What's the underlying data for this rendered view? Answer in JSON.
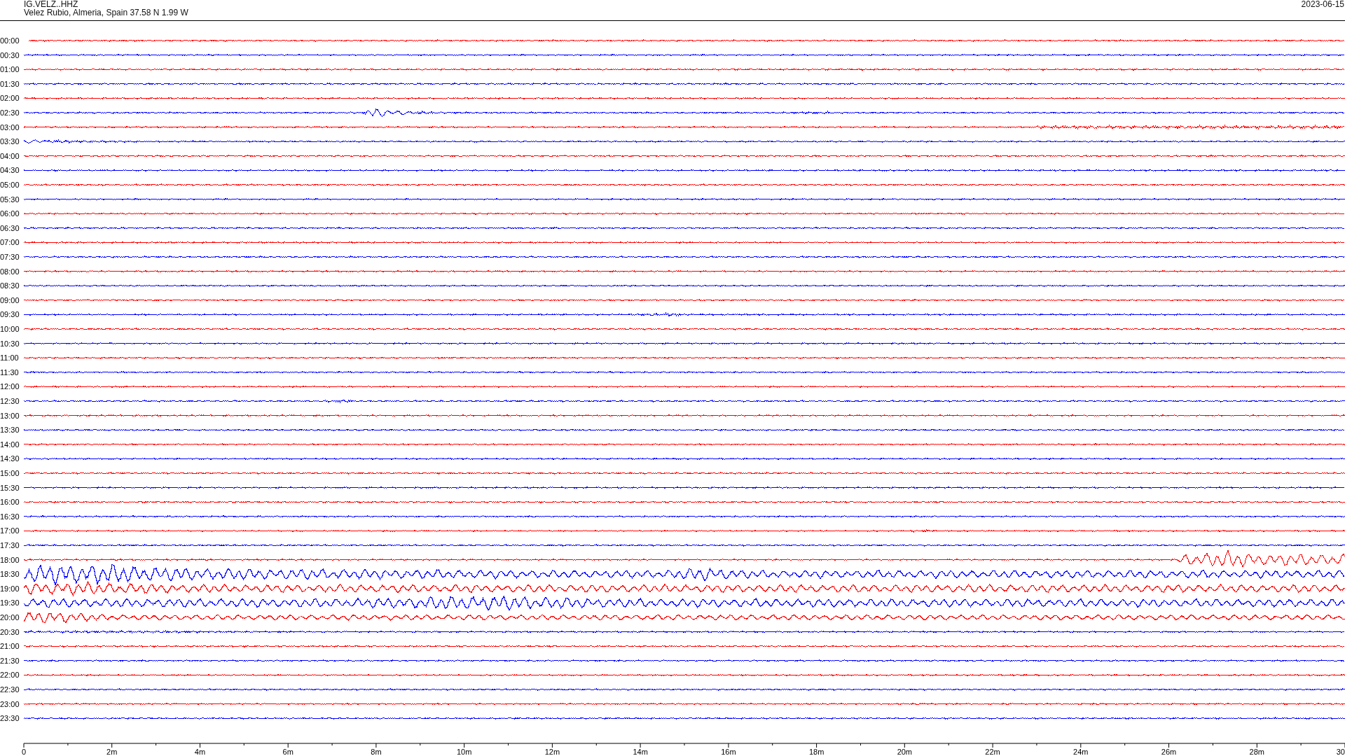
{
  "header": {
    "station": "IG.VELZ..HHZ",
    "location": "Velez Rubio, Almeria, Spain  37.58 N 1.99 W",
    "date": "2023-06-15"
  },
  "traces": [
    {
      "label": "00:00",
      "color": "#ff0000"
    },
    {
      "label": "00:30",
      "color": "#0000ff"
    },
    {
      "label": "01:00",
      "color": "#ff0000"
    },
    {
      "label": "01:30",
      "color": "#0000ff"
    },
    {
      "label": "02:00",
      "color": "#ff0000"
    },
    {
      "label": "02:30",
      "color": "#0000ff"
    },
    {
      "label": "03:00",
      "color": "#ff0000"
    },
    {
      "label": "03:30",
      "color": "#0000ff"
    },
    {
      "label": "04:00",
      "color": "#ff0000"
    },
    {
      "label": "04:30",
      "color": "#0000ff"
    },
    {
      "label": "05:00",
      "color": "#ff0000"
    },
    {
      "label": "05:30",
      "color": "#0000ff"
    },
    {
      "label": "06:00",
      "color": "#ff0000"
    },
    {
      "label": "06:30",
      "color": "#0000ff"
    },
    {
      "label": "07:00",
      "color": "#ff0000"
    },
    {
      "label": "07:30",
      "color": "#0000ff"
    },
    {
      "label": "08:00",
      "color": "#ff0000"
    },
    {
      "label": "08:30",
      "color": "#0000ff"
    },
    {
      "label": "09:00",
      "color": "#ff0000"
    },
    {
      "label": "09:30",
      "color": "#0000ff"
    },
    {
      "label": "10:00",
      "color": "#ff0000"
    },
    {
      "label": "10:30",
      "color": "#0000ff"
    },
    {
      "label": "11:00",
      "color": "#ff0000"
    },
    {
      "label": "11:30",
      "color": "#0000ff"
    },
    {
      "label": "12:00",
      "color": "#ff0000"
    },
    {
      "label": "12:30",
      "color": "#0000ff"
    },
    {
      "label": "13:00",
      "color": "#ff0000"
    },
    {
      "label": "13:30",
      "color": "#0000ff"
    },
    {
      "label": "14:00",
      "color": "#ff0000"
    },
    {
      "label": "14:30",
      "color": "#0000ff"
    },
    {
      "label": "15:00",
      "color": "#ff0000"
    },
    {
      "label": "15:30",
      "color": "#0000ff"
    },
    {
      "label": "16:00",
      "color": "#ff0000"
    },
    {
      "label": "16:30",
      "color": "#0000ff"
    },
    {
      "label": "17:00",
      "color": "#ff0000"
    },
    {
      "label": "17:30",
      "color": "#0000ff"
    },
    {
      "label": "18:00",
      "color": "#ff0000"
    },
    {
      "label": "18:30",
      "color": "#0000ff"
    },
    {
      "label": "19:00",
      "color": "#ff0000"
    },
    {
      "label": "19:30",
      "color": "#0000ff"
    },
    {
      "label": "20:00",
      "color": "#ff0000"
    },
    {
      "label": "20:30",
      "color": "#0000ff"
    },
    {
      "label": "21:00",
      "color": "#ff0000"
    },
    {
      "label": "21:30",
      "color": "#0000ff"
    },
    {
      "label": "22:00",
      "color": "#ff0000"
    },
    {
      "label": "22:30",
      "color": "#0000ff"
    },
    {
      "label": "23:00",
      "color": "#ff0000"
    },
    {
      "label": "23:30",
      "color": "#0000ff"
    }
  ],
  "axis_labels": [
    "0",
    "2m",
    "4m",
    "6m",
    "8m",
    "10m",
    "12m",
    "14m",
    "16m",
    "18m",
    "20m",
    "22m",
    "24m",
    "26m",
    "28m",
    "30"
  ]
}
